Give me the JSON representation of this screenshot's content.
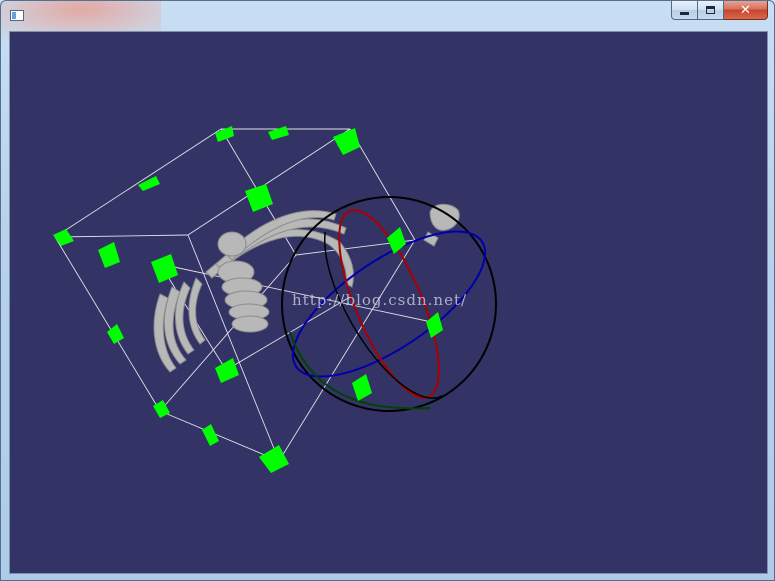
{
  "window": {
    "title": "",
    "controls": {
      "minimize": "minimize",
      "maximize": "maximize",
      "close": "close"
    }
  },
  "viewport": {
    "background": "#333366",
    "widget_color": "#00ff00",
    "box_wire_color": "#ffffff",
    "ring_colors": [
      "#000000",
      "#aa0000",
      "#0000aa",
      "#004400"
    ],
    "watermark": "http://blog.csdn.net/"
  }
}
